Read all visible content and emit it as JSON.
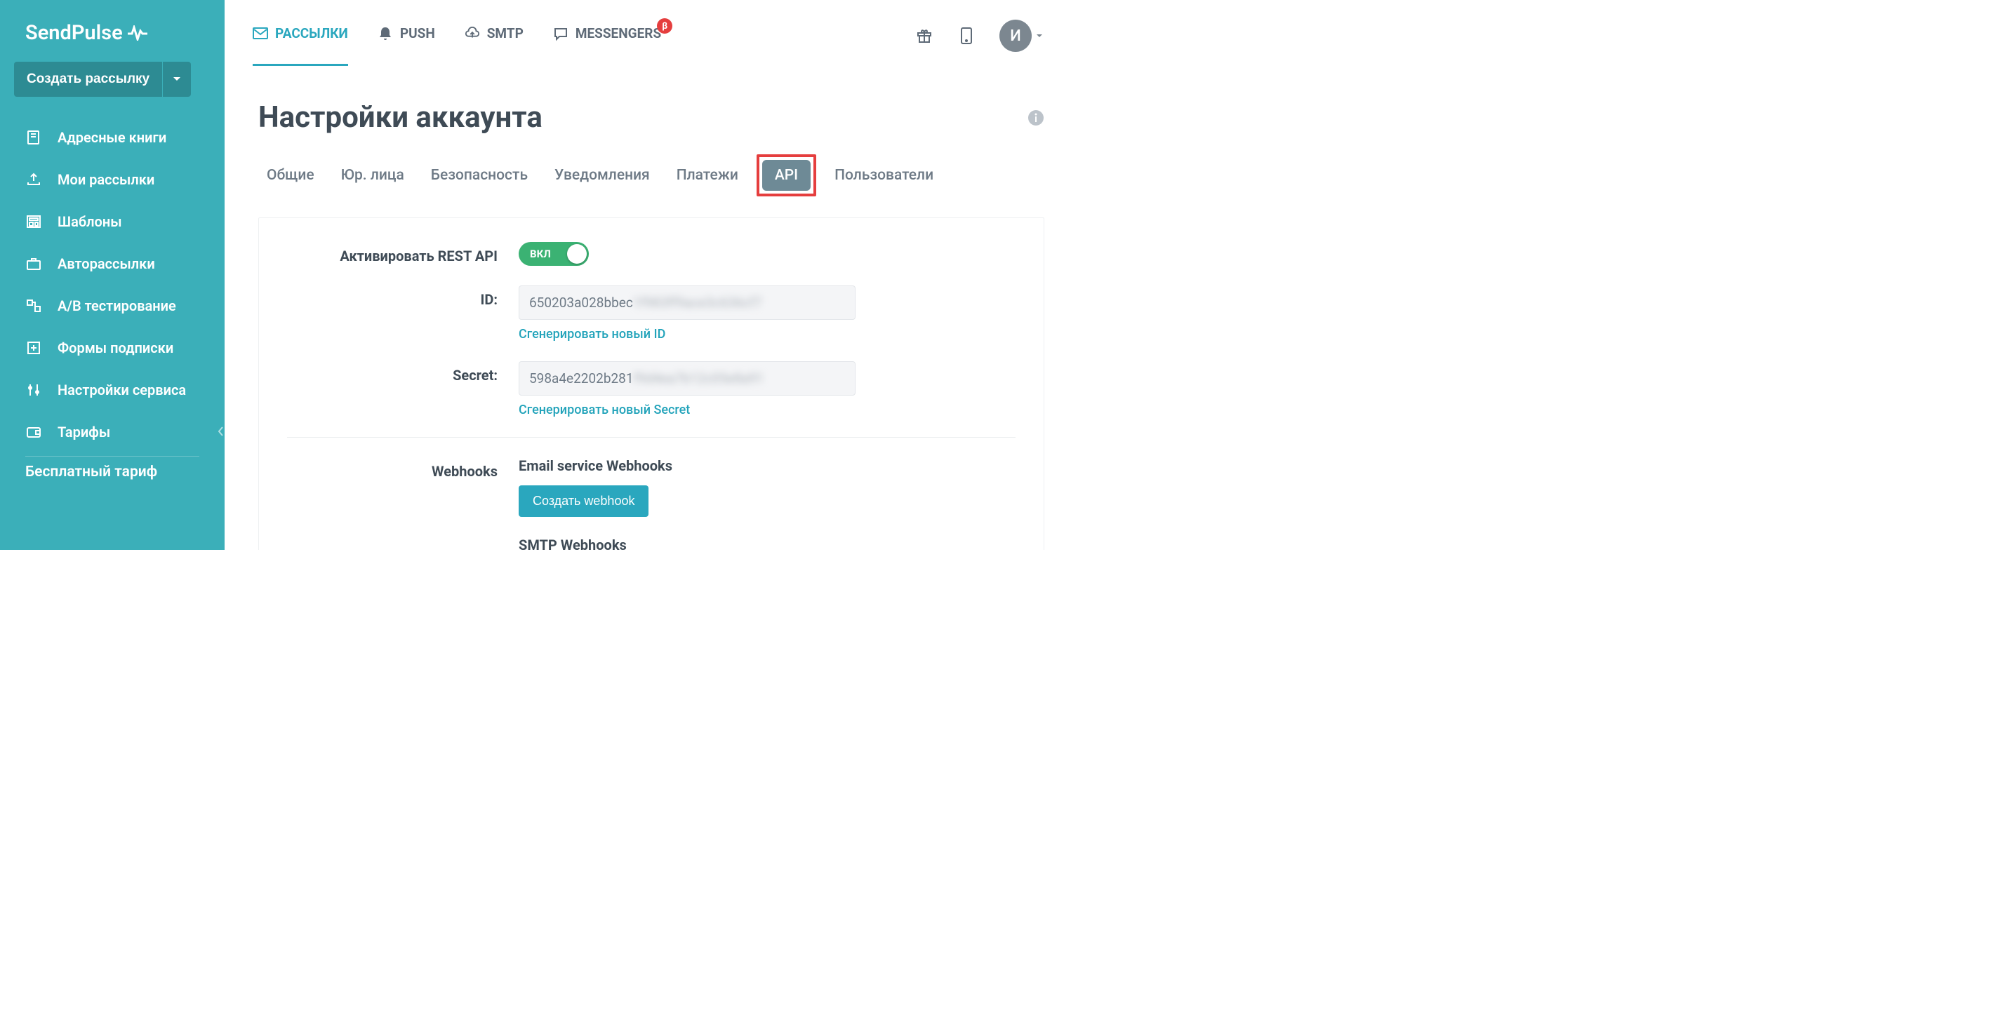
{
  "brand": {
    "name": "SendPulse"
  },
  "sidebar": {
    "create_label": "Создать рассылку",
    "items": [
      {
        "label": "Адресные книги"
      },
      {
        "label": "Мои рассылки"
      },
      {
        "label": "Шаблоны"
      },
      {
        "label": "Авторассылки"
      },
      {
        "label": "A/B тестирование"
      },
      {
        "label": "Формы подписки"
      },
      {
        "label": "Настройки сервиса"
      },
      {
        "label": "Тарифы"
      }
    ],
    "footer": "Бесплатный тариф"
  },
  "topnav": {
    "items": [
      {
        "label": "РАССЫЛКИ"
      },
      {
        "label": "PUSH"
      },
      {
        "label": "SMTP"
      },
      {
        "label": "MESSENGERS",
        "badge": "β"
      }
    ],
    "avatar_initial": "И"
  },
  "page": {
    "title": "Настройки аккаунта",
    "tabs": [
      {
        "label": "Общие"
      },
      {
        "label": "Юр. лица"
      },
      {
        "label": "Безопасность"
      },
      {
        "label": "Уведомления"
      },
      {
        "label": "Платежи"
      },
      {
        "label": "API",
        "active": true
      },
      {
        "label": "Пользователи"
      }
    ]
  },
  "api": {
    "activate_label": "Активировать REST API",
    "toggle_label": "ВКЛ",
    "id_label": "ID:",
    "id_value_visible": "650203a028bbec",
    "id_value_blur": "1f983ff9ace3c636cf7",
    "id_regen": "Сгенерировать новый ID",
    "secret_label": "Secret:",
    "secret_value_visible": "598a4e2202b281",
    "secret_value_blur": "f9d4ea7b12c05e8a91",
    "secret_regen": "Сгенерировать новый Secret",
    "webhooks_label": "Webhooks",
    "email_webhooks_heading": "Email service Webhooks",
    "create_webhook_btn": "Создать webhook",
    "smtp_webhooks_heading": "SMTP Webhooks"
  }
}
